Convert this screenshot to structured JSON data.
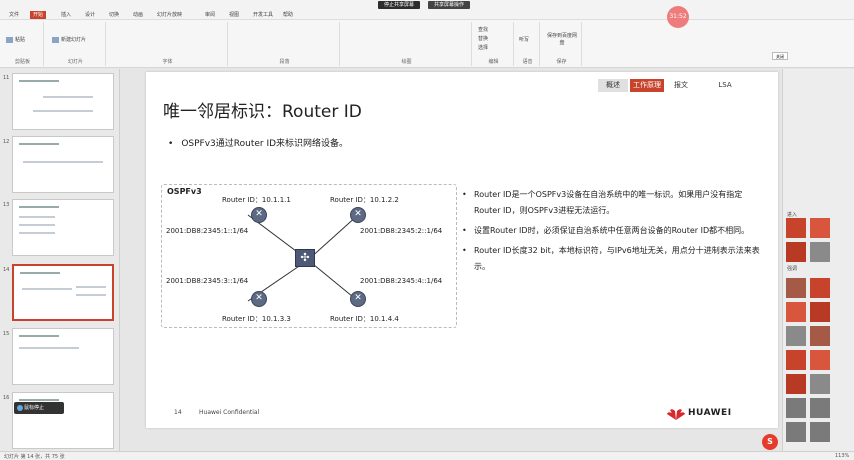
{
  "titlebar": {
    "tabs": [
      "文件",
      "开始",
      "插入",
      "设计",
      "切换",
      "动画",
      "幻灯片放映",
      "审阅",
      "视图",
      "开发工具",
      "帮助"
    ],
    "meeting": {
      "share_label": "停止共享屏幕",
      "screen_label": "共享屏幕操作"
    },
    "timer": "31:52"
  },
  "ribbon": {
    "groups": [
      "剪贴板",
      "幻灯片",
      "字体",
      "段落",
      "绘图",
      "编辑",
      "语音",
      "保存"
    ],
    "paste_label": "粘贴",
    "new_slide_label": "新建幻灯片",
    "find_label": "查找",
    "replace_label": "替换",
    "select_label": "选择",
    "dictate_label": "听写",
    "save_label": "保存到百度网盘"
  },
  "thumbnails": [
    {
      "num": "11"
    },
    {
      "num": "12"
    },
    {
      "num": "13"
    },
    {
      "num": "14"
    },
    {
      "num": "15"
    },
    {
      "num": "16"
    }
  ],
  "chat_popup": "鼠标停止",
  "slide": {
    "nav_tabs": [
      "概述",
      "工作原理",
      "报文",
      "LSA"
    ],
    "title": "唯一邻居标识：Router ID",
    "bullet": "OSPFv3通过Router ID来标识网络设备。",
    "diagram": {
      "label": "OSPFv3",
      "routers": [
        {
          "id": "Router ID：10.1.1.1",
          "iface": "2001:DB8:2345:1::1/64"
        },
        {
          "id": "Router ID：10.1.2.2",
          "iface": "2001:DB8:2345:2::1/64"
        },
        {
          "id": "Router ID：10.1.3.3",
          "iface": "2001:DB8:2345:3::1/64"
        },
        {
          "id": "Router ID：10.1.4.4",
          "iface": "2001:DB8:2345:4::1/64"
        }
      ]
    },
    "right_bullets": [
      "Router ID是一个OSPFv3设备在自治系统中的唯一标识。如果用户没有指定Router ID，则OSPFv3进程无法运行。",
      "设置Router ID时，必须保证自治系统中任意两台设备的Router ID都不相同。",
      "Router ID长度32 bit，本地标识符，与IPv6地址无关，用点分十进制表示法来表示。"
    ],
    "page_number": "14",
    "confidential": "Huawei Confidential",
    "logo_text": "HUAWEI"
  },
  "right_pane": {
    "section1": "进入",
    "section2": "强调",
    "close": "关闭"
  },
  "statusbar": {
    "left": "幻灯片 第 14 张，共 75 张",
    "zoom": "113%"
  },
  "colors": {
    "accent": "#c8432b",
    "router": "#5d6a83",
    "anim_red": "#c8432b"
  }
}
